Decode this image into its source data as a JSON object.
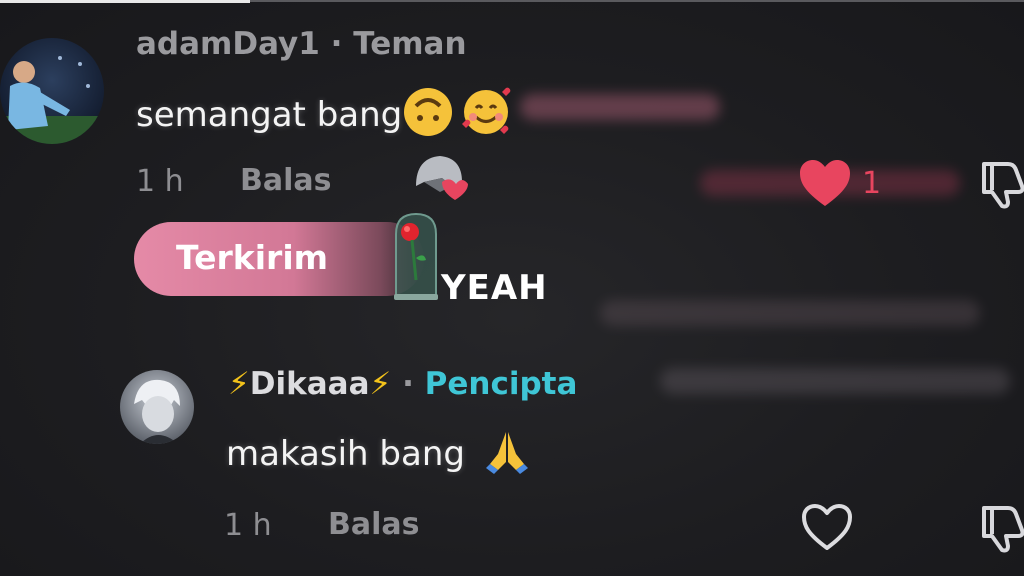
{
  "comments": [
    {
      "username": "adamDay1",
      "separator": "·",
      "relation": "Teman",
      "text": "semangat bang",
      "emojis": [
        "upside-down-face",
        "smiling-face-with-hearts"
      ],
      "time": "1 h",
      "reply_label": "Balas",
      "like_count": "1",
      "liked": true
    },
    {
      "username_prefix": "⚡",
      "username": "Dikaaa",
      "username_suffix": "⚡",
      "separator": "·",
      "relation": "Pencipta",
      "text": "makasih bang",
      "emojis": [
        "folded-hands"
      ],
      "time": "1 h",
      "reply_label": "Balas",
      "liked": false
    }
  ],
  "gift": {
    "sent_label": "Terkirim",
    "overlay_text": "YEAH",
    "icon": "rose-in-glass-dome"
  },
  "colors": {
    "background": "#1d1d20",
    "liked_heart": "#e8455f",
    "creator_label": "#3fc6d6",
    "pill_gradient_start": "#e58aa7",
    "lightning": "#f2c21b"
  }
}
